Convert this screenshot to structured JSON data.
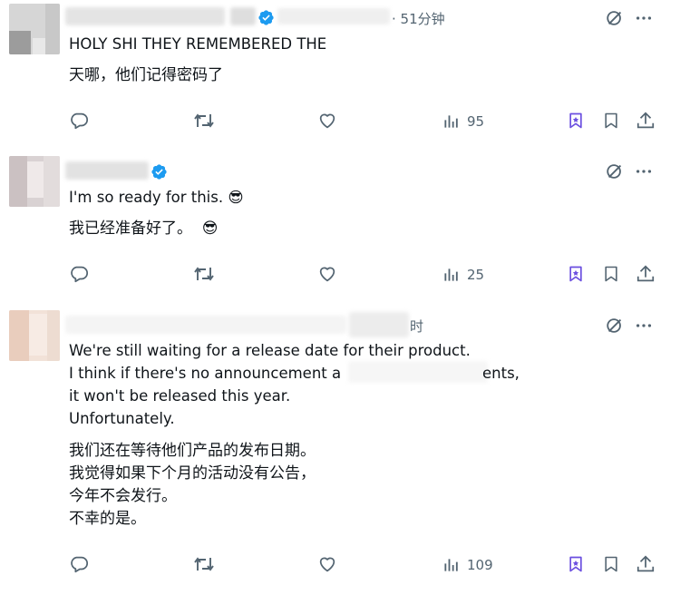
{
  "posts": [
    {
      "time": "· 51分钟",
      "lines": [
        "HOLY SHI THEY REMEMBERED THE"
      ],
      "translation": [
        "天哪，他们记得密码了"
      ],
      "views": "95"
    },
    {
      "lines": [
        "I'm so ready for this. 😎"
      ],
      "translation": [
        "我已经准备好了。  😎"
      ],
      "views": "25"
    },
    {
      "time_fragment": "时",
      "lines": [
        "We're still waiting for a release date for their product.",
        "I think if there's no announcement a",
        "ents,",
        "it won't be released this year.",
        "Unfortunately."
      ],
      "translation": [
        "我们还在等待他们产品的发布日期。",
        "我觉得如果下个月的活动没有公告，",
        "今年不会发行。",
        "不幸的是。"
      ],
      "views": "109"
    }
  ],
  "icons": {
    "reply": "reply-icon",
    "retweet": "retweet-icon",
    "like": "like-icon",
    "views": "views-icon",
    "grok": "grok-icon",
    "bookmark": "bookmark-icon",
    "share": "share-icon",
    "more": "more-icon",
    "verified": "verified-badge-icon"
  },
  "colors": {
    "text": "#0f1419",
    "muted": "#536471",
    "verified": "#1d9bf0",
    "grok": "#6b4fe0"
  }
}
